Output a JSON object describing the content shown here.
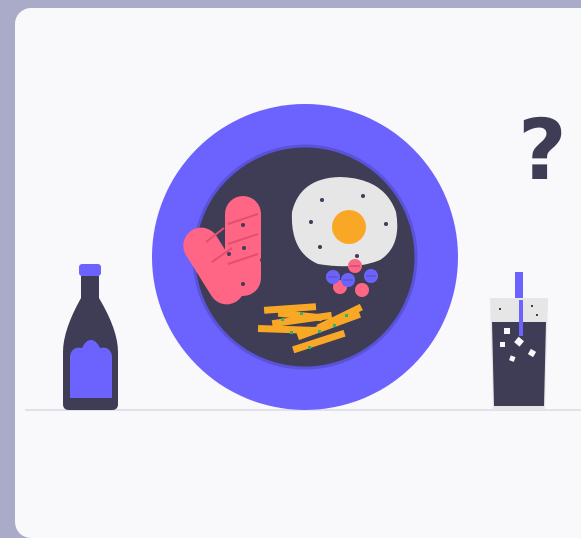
{
  "illustration": {
    "mark": "?",
    "icons": [
      "sauce-bottle-icon",
      "breakfast-plate-icon",
      "sausage-icon",
      "fried-egg-icon",
      "fries-icon",
      "berries-icon",
      "soda-glass-icon",
      "question-mark-icon"
    ],
    "colors": {
      "background": "#a9abc8",
      "card": "#f9f9fc",
      "plate_rim": "#6c63ff",
      "plate_center": "#3f3d56",
      "sausage": "#ff6584",
      "yolk": "#f9a825",
      "fries": "#f9a825",
      "glass": "#e6e6e6"
    }
  }
}
